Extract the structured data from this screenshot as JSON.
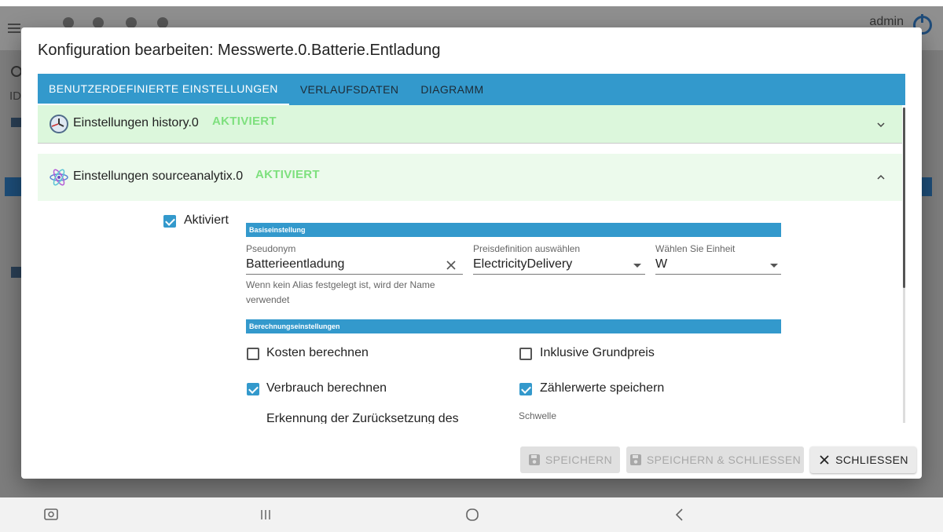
{
  "background": {
    "user": "admin",
    "id_label": "ID"
  },
  "dialog": {
    "title": "Konfiguration bearbeiten: Messwerte.0.Batterie.Entladung",
    "tabs": [
      {
        "label": "BENUTZERDEFINIERTE EINSTELLUNGEN",
        "active": true
      },
      {
        "label": "VERLAUFSDATEN",
        "active": false
      },
      {
        "label": "DIAGRAMM",
        "active": false
      }
    ],
    "accordions": [
      {
        "title": "Einstellungen history.0",
        "status": "AKTIVIERT",
        "expanded": false,
        "icon": "clock-icon"
      },
      {
        "title": "Einstellungen sourceanalytix.0",
        "status": "AKTIVIERT",
        "expanded": true,
        "icon": "atom-icon"
      }
    ],
    "enabled": {
      "label": "Aktiviert",
      "checked": true
    },
    "basic_section": {
      "title": "Basiseinstellung",
      "alias": {
        "label": "Pseudonym",
        "value": "Batterieentladung",
        "helper": "Wenn kein Alias festgelegt ist, wird der Name verwendet"
      },
      "price": {
        "label": "Preisdefinition auswählen",
        "value": "ElectricityDelivery"
      },
      "unit": {
        "label": "Wählen Sie Einheit",
        "value": "W"
      }
    },
    "calc_section": {
      "title": "Berechnungseinstellungen",
      "costs": {
        "label": "Kosten berechnen",
        "checked": false
      },
      "base_price": {
        "label": "Inklusive Grundpreis",
        "checked": false
      },
      "consumption": {
        "label": "Verbrauch berechnen",
        "checked": true
      },
      "meter_values": {
        "label": "Zählerwerte speichern",
        "checked": true
      },
      "reset_detection": {
        "label": "Erkennung der Zurücksetzung des"
      },
      "threshold": {
        "label": "Schwelle"
      }
    },
    "buttons": {
      "save": "SPEICHERN",
      "save_close": "SPEICHERN & SCHLIESSEN",
      "close": "SCHLIESSEN"
    }
  },
  "colors": {
    "accent": "#3399cc",
    "status_green": "#7ee07e",
    "accordion_bg": "#dcf7dc"
  }
}
